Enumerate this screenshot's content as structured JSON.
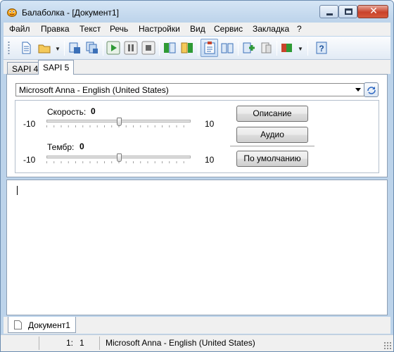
{
  "window": {
    "title": "Балаболка - [Документ1]",
    "close_symbol": "✕"
  },
  "menu": [
    "Файл",
    "Правка",
    "Текст",
    "Речь",
    "Настройки",
    "Вид",
    "Сервис",
    "Закладка",
    "?"
  ],
  "toolbar": {
    "buttons": [
      "new-document",
      "open-folder",
      "convert-to-audio",
      "batch-convert",
      "play",
      "pause",
      "stop",
      "previous-sentence",
      "next-sentence",
      "speak-clipboard",
      "read-aloud",
      "add-file",
      "remove-file",
      "voice-settings",
      "help"
    ],
    "dropdown_glyph": "▼"
  },
  "sapi_tabs": [
    "SAPI 4",
    "SAPI 5"
  ],
  "sapi_selected": "SAPI 5",
  "voice": {
    "selected": "Microsoft Anna - English (United States)"
  },
  "rate": {
    "label": "Скорость:",
    "value": "0",
    "min": "-10",
    "max": "10",
    "level": 0.5
  },
  "pitch": {
    "label": "Тембр:",
    "value": "0",
    "min": "-10",
    "max": "10",
    "level": 0.5
  },
  "buttons": {
    "description": "Описание",
    "audio": "Аудио",
    "default": "По умолчанию"
  },
  "document_tab": "Документ1",
  "status": {
    "line": "1:",
    "col": "1",
    "voice": "Microsoft Anna - English (United States)"
  },
  "colors": {
    "accent": "#bcd3ea",
    "play": "#2e9a35",
    "close": "#c9432b"
  }
}
